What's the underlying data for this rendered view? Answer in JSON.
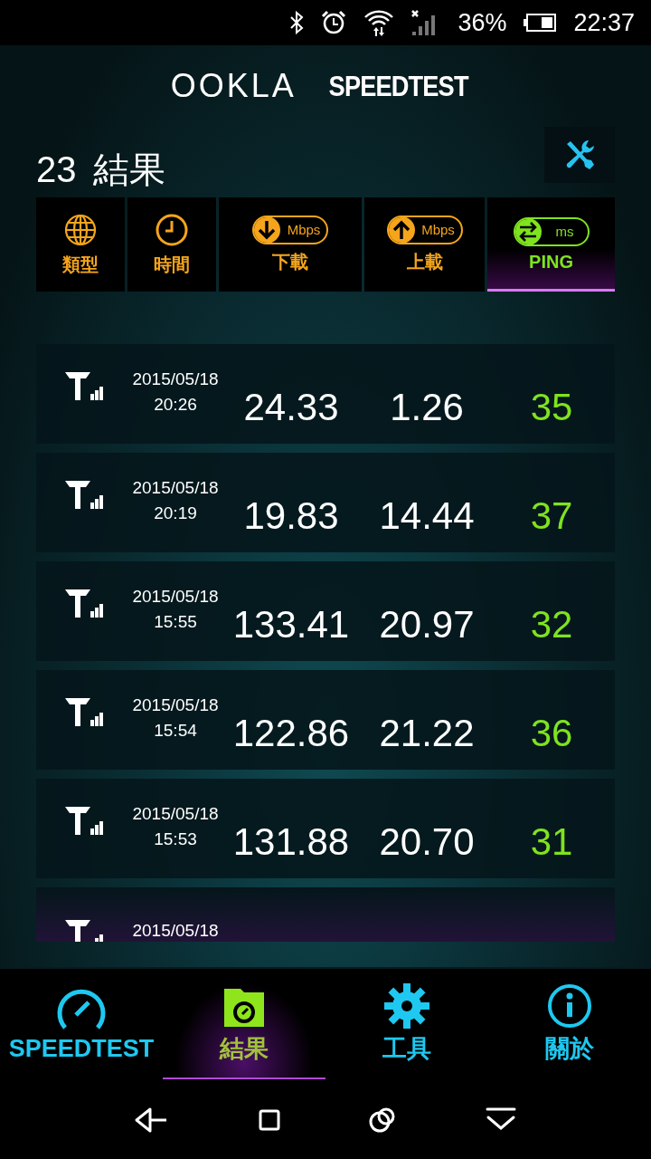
{
  "status_bar": {
    "battery_text": "36%",
    "time": "22:37"
  },
  "header": {
    "brand": "OOKLA",
    "product": "SPEEDTEST"
  },
  "results_title": {
    "count": "23",
    "label": "結果"
  },
  "sort_columns": [
    {
      "kind": "type",
      "label": "類型",
      "selected": false
    },
    {
      "kind": "time",
      "label": "時間",
      "selected": false
    },
    {
      "kind": "download",
      "label": "下載",
      "unit": "Mbps",
      "selected": false
    },
    {
      "kind": "upload",
      "label": "上載",
      "unit": "Mbps",
      "selected": false
    },
    {
      "kind": "ping",
      "label": "PING",
      "unit": "ms",
      "selected": true
    }
  ],
  "results": [
    {
      "date": "2015/05/18",
      "time": "20:26",
      "download": "24.33",
      "upload": "1.26",
      "ping": "35"
    },
    {
      "date": "2015/05/18",
      "time": "20:19",
      "download": "19.83",
      "upload": "14.44",
      "ping": "37"
    },
    {
      "date": "2015/05/18",
      "time": "15:55",
      "download": "133.41",
      "upload": "20.97",
      "ping": "32"
    },
    {
      "date": "2015/05/18",
      "time": "15:54",
      "download": "122.86",
      "upload": "21.22",
      "ping": "36"
    },
    {
      "date": "2015/05/18",
      "time": "15:53",
      "download": "131.88",
      "upload": "20.70",
      "ping": "31"
    },
    {
      "date": "2015/05/18"
    }
  ],
  "bottom_nav": [
    {
      "kind": "speedtest",
      "label": "SPEEDTEST",
      "selected": false
    },
    {
      "kind": "results",
      "label": "結果",
      "selected": true
    },
    {
      "kind": "tools",
      "label": "工具",
      "selected": false
    },
    {
      "kind": "about",
      "label": "關於",
      "selected": false
    }
  ]
}
